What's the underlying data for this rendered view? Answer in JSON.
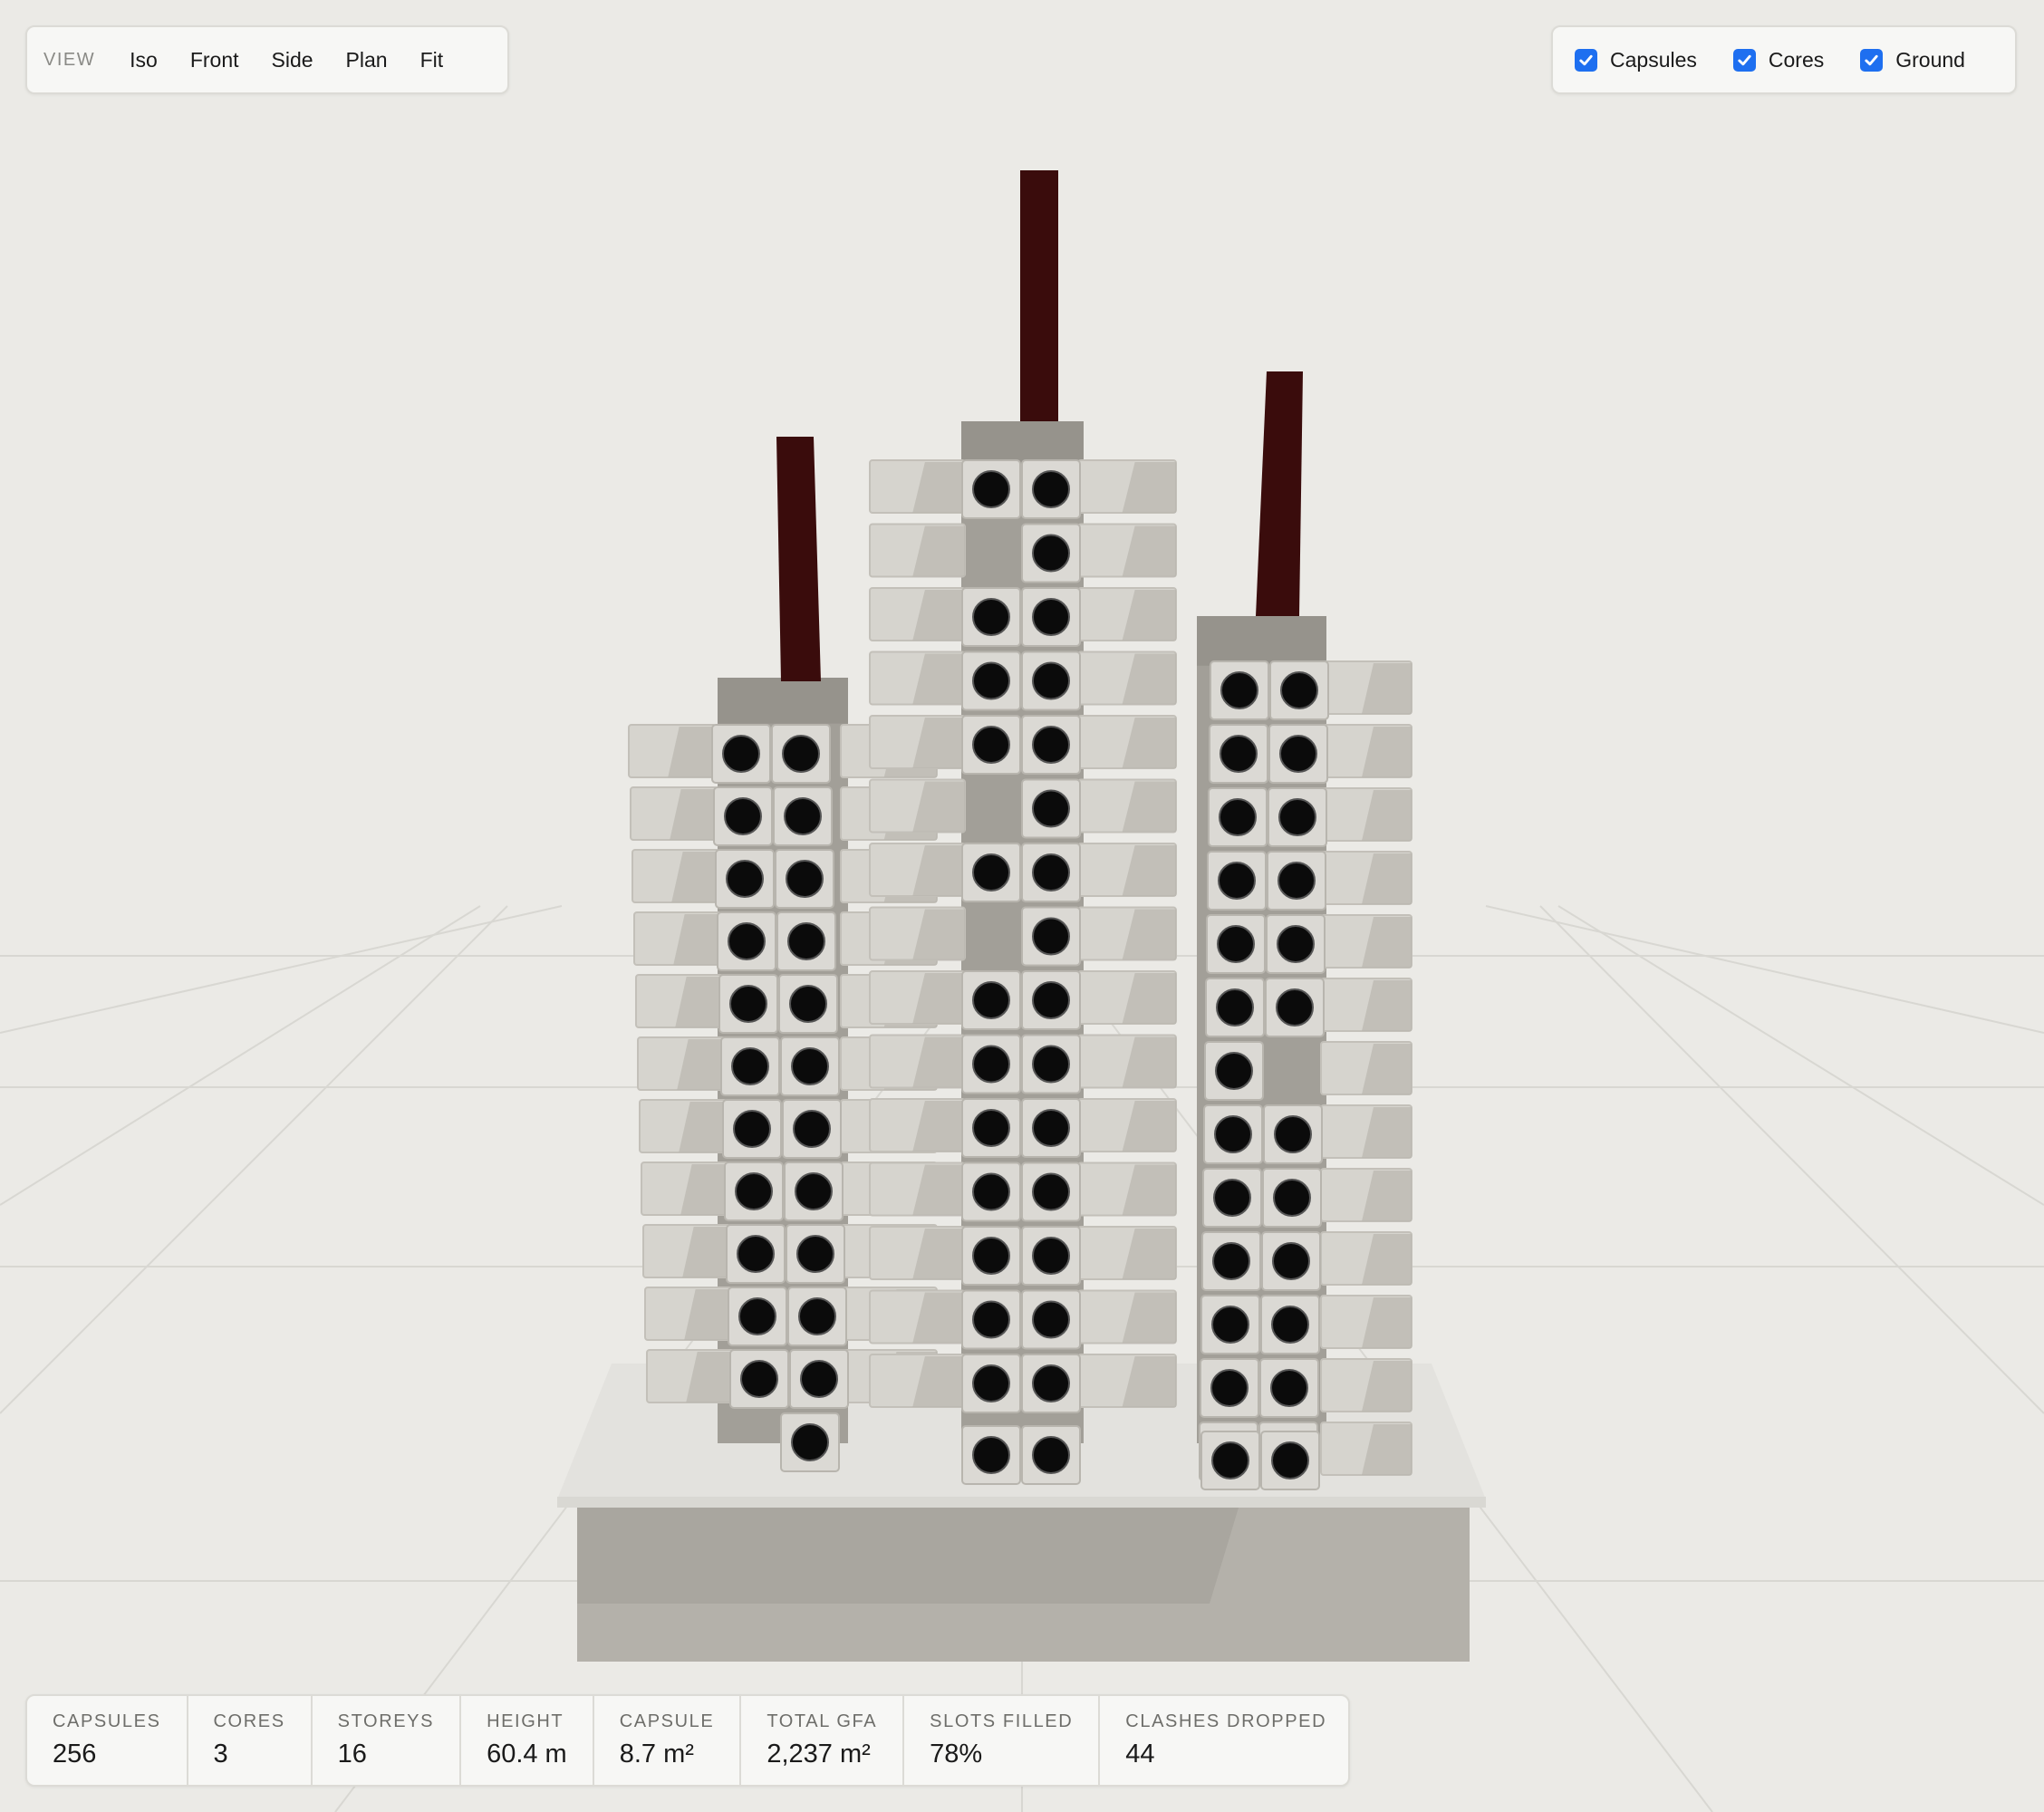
{
  "toolbar": {
    "label": "VIEW",
    "buttons": [
      "Iso",
      "Front",
      "Side",
      "Plan",
      "Fit"
    ]
  },
  "layers": [
    {
      "label": "Capsules",
      "checked": true
    },
    {
      "label": "Cores",
      "checked": true
    },
    {
      "label": "Ground",
      "checked": true
    }
  ],
  "stats": [
    {
      "label": "CAPSULES",
      "value": "256"
    },
    {
      "label": "CORES",
      "value": "3"
    },
    {
      "label": "STOREYS",
      "value": "16"
    },
    {
      "label": "HEIGHT",
      "value": "60.4 m"
    },
    {
      "label": "CAPSULE",
      "value": "8.7 m²"
    },
    {
      "label": "TOTAL GFA",
      "value": "2,237 m²"
    },
    {
      "label": "SLOTS FILLED",
      "value": "78%"
    },
    {
      "label": "CLASHES DROPPED",
      "value": "44"
    }
  ],
  "colors": {
    "background": "#ebeae6",
    "capsule": "#d6d4ce",
    "capsule_side": "#b9b6af",
    "core": "#a29f98",
    "porthole": "#0b0b0b",
    "spire": "#3a0c0c",
    "plinth_top": "#e3e2de",
    "plinth_side": "#b4b1aa",
    "accent": "#1e6ff0"
  }
}
